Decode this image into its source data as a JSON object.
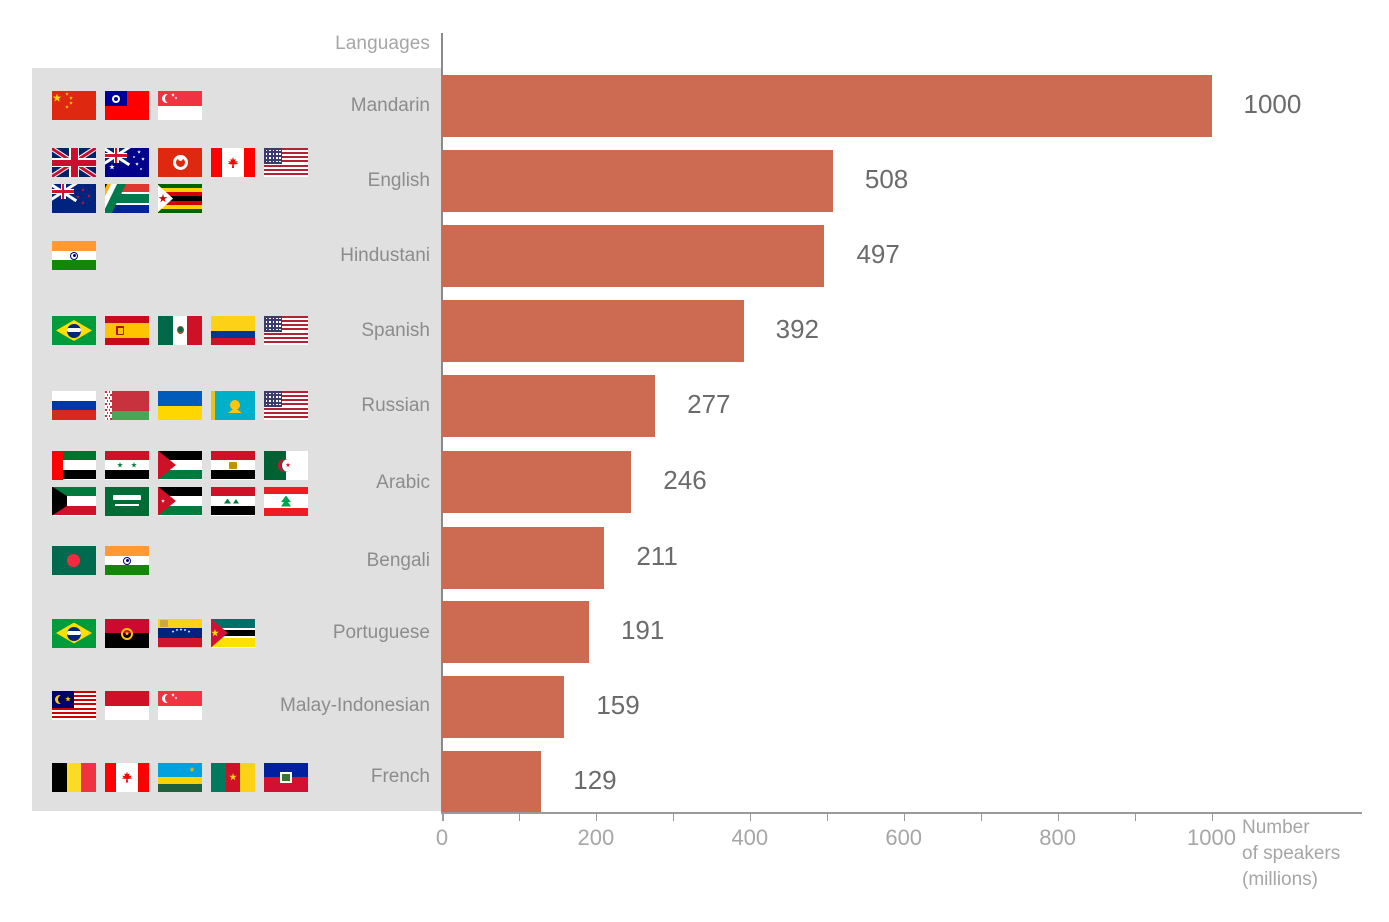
{
  "chart_data": {
    "type": "bar",
    "orientation": "horizontal",
    "title": "",
    "category_axis_title": "Languages",
    "value_axis_title_lines": [
      "Number",
      "of speakers",
      "(millions)"
    ],
    "value_axis_title": "Number of speakers (millions)",
    "categories": [
      "Mandarin",
      "English",
      "Hindustani",
      "Spanish",
      "Russian",
      "Arabic",
      "Bengali",
      "Portuguese",
      "Malay-Indonesian",
      "French"
    ],
    "values": [
      1000,
      508,
      497,
      392,
      277,
      246,
      211,
      191,
      159,
      129
    ],
    "value_labels": [
      "1000",
      "508",
      "497",
      "392",
      "277",
      "246",
      "211",
      "191",
      "159",
      "129"
    ],
    "xlim": [
      0,
      1040
    ],
    "xticks": [
      0,
      100,
      200,
      300,
      400,
      500,
      600,
      700,
      800,
      900,
      1000
    ],
    "xtick_labels": [
      {
        "value": 0,
        "label": "0"
      },
      {
        "value": 200,
        "label": "200"
      },
      {
        "value": 400,
        "label": "400"
      },
      {
        "value": 600,
        "label": "600"
      },
      {
        "value": 800,
        "label": "800"
      },
      {
        "value": 1000,
        "label": "1000"
      }
    ],
    "grid": false,
    "legend": "none",
    "bar_color": "#cc6b52",
    "panel_color": "#e0e0e0",
    "label_color": "#8c8c8c",
    "axis_color": "#a6a6a6",
    "value_label_color": "#6b6b6b",
    "rows": [
      {
        "language": "Mandarin",
        "value": 1000,
        "value_label": "1000",
        "flags": [
          "china",
          "taiwan",
          "singapore"
        ]
      },
      {
        "language": "English",
        "value": 508,
        "value_label": "508",
        "flags": [
          "united-kingdom",
          "australia",
          "hong-kong",
          "canada",
          "united-states",
          "new-zealand",
          "south-africa",
          "zimbabwe"
        ]
      },
      {
        "language": "Hindustani",
        "value": 497,
        "value_label": "497",
        "flags": [
          "india"
        ]
      },
      {
        "language": "Spanish",
        "value": 392,
        "value_label": "392",
        "flags": [
          "brazil",
          "spain",
          "mexico",
          "colombia",
          "united-states"
        ]
      },
      {
        "language": "Russian",
        "value": 277,
        "value_label": "277",
        "flags": [
          "russia",
          "belarus",
          "ukraine",
          "kazakhstan",
          "united-states"
        ]
      },
      {
        "language": "Arabic",
        "value": 246,
        "value_label": "246",
        "flags": [
          "united-arab-emirates",
          "syria",
          "palestine",
          "egypt",
          "algeria",
          "kuwait",
          "saudi-arabia",
          "jordan",
          "iraq",
          "lebanon"
        ]
      },
      {
        "language": "Bengali",
        "value": 211,
        "value_label": "211",
        "flags": [
          "bangladesh",
          "india"
        ]
      },
      {
        "language": "Portuguese",
        "value": 191,
        "value_label": "191",
        "flags": [
          "brazil",
          "angola",
          "venezuela",
          "mozambique"
        ]
      },
      {
        "language": "Malay-Indonesian",
        "value": 159,
        "value_label": "159",
        "flags": [
          "malaysia",
          "indonesia",
          "singapore"
        ]
      },
      {
        "language": "French",
        "value": 129,
        "value_label": "129",
        "flags": [
          "belgium",
          "canada",
          "rwanda",
          "cameroon",
          "haiti"
        ]
      }
    ]
  }
}
